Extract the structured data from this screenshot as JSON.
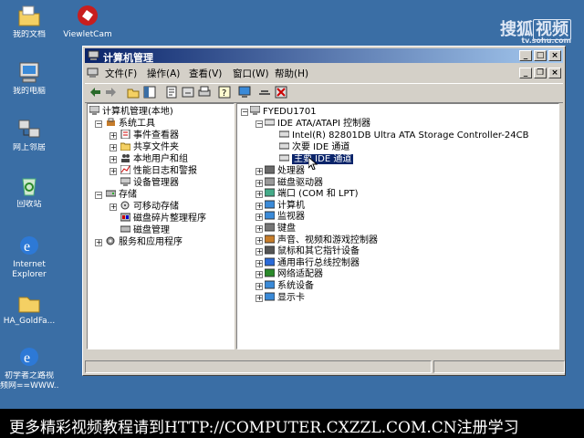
{
  "desktop": {
    "icons": [
      {
        "label": "我的文档",
        "icon": "folder-icon"
      },
      {
        "label": "ViewletCam",
        "icon": "viewletcam-icon"
      },
      {
        "label": "我的电脑",
        "icon": "computer-icon"
      },
      {
        "label": "网上邻居",
        "icon": "network-icon"
      },
      {
        "label": "回收站",
        "icon": "recycle-bin-icon"
      },
      {
        "label": "Internet",
        "label2": "Explorer",
        "icon": "ie-icon"
      },
      {
        "label": "HA_GoldFa...",
        "icon": "folder-icon"
      },
      {
        "label": "初学者之路视",
        "label2": "频网==WWW...",
        "icon": "ie-icon"
      }
    ]
  },
  "window": {
    "title": "计算机管理",
    "menus": [
      "文件(F)",
      "操作(A)",
      "查看(V)",
      "窗口(W)",
      "帮助(H)"
    ],
    "left_tree": {
      "root": "计算机管理(本地)",
      "items": [
        {
          "label": "系统工具",
          "level": 1
        },
        {
          "label": "事件查看器",
          "level": 2
        },
        {
          "label": "共享文件夹",
          "level": 2
        },
        {
          "label": "本地用户和组",
          "level": 2
        },
        {
          "label": "性能日志和警报",
          "level": 2
        },
        {
          "label": "设备管理器",
          "level": 2
        },
        {
          "label": "存储",
          "level": 1
        },
        {
          "label": "可移动存储",
          "level": 2
        },
        {
          "label": "磁盘碎片整理程序",
          "level": 2
        },
        {
          "label": "磁盘管理",
          "level": 2
        },
        {
          "label": "服务和应用程序",
          "level": 1
        }
      ]
    },
    "right_tree": {
      "root": "FYEDU1701",
      "ide_group": "IDE ATA/ATAPI 控制器",
      "ide_children": [
        "Intel(R) 82801DB Ultra ATA Storage Controller-24CB",
        "次要 IDE 通道",
        "主要 IDE 通道"
      ],
      "categories": [
        "处理器",
        "磁盘驱动器",
        "端口 (COM 和 LPT)",
        "计算机",
        "监视器",
        "键盘",
        "声音、视频和游戏控制器",
        "鼠标和其它指针设备",
        "通用串行总线控制器",
        "网络适配器",
        "系统设备",
        "显示卡"
      ]
    }
  },
  "banner": {
    "text": "更多精彩视频教程请到HTTP://COMPUTER.CXZZL.COM.CN注册学习"
  },
  "watermark": {
    "brand_a": "搜狐",
    "brand_b": "视频",
    "sub": "tv.sohu.com"
  }
}
